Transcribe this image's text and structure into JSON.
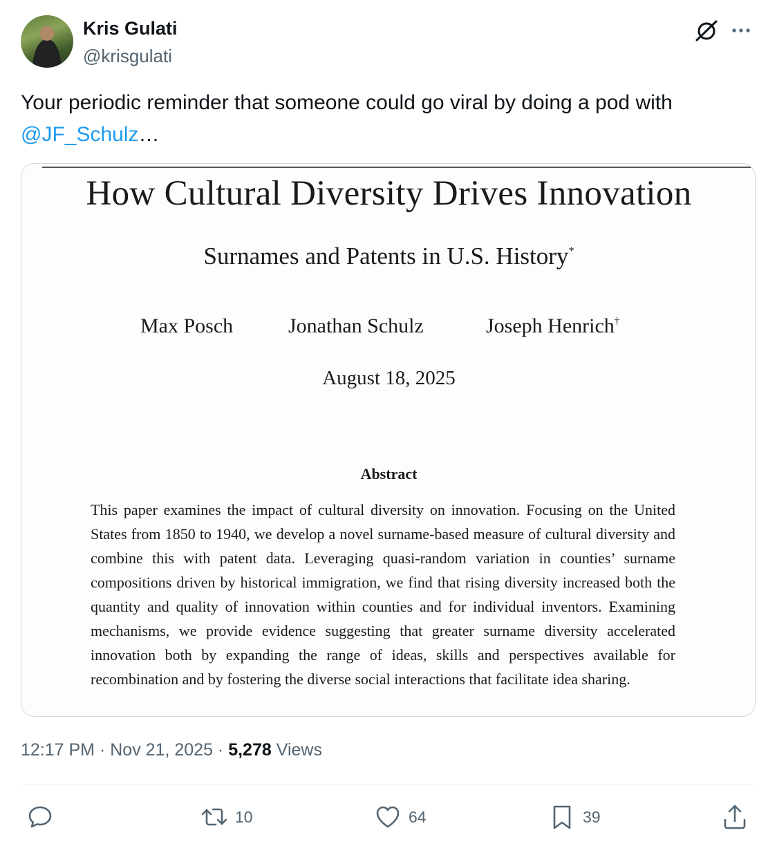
{
  "author": {
    "name": "Kris Gulati",
    "handle": "@krisgulati",
    "avatar_icon": "profile-photo"
  },
  "tweet": {
    "text": "Your periodic reminder that someone  could go viral by doing a pod with",
    "mention": "@JF_Schulz",
    "ellipsis": "…"
  },
  "media": {
    "title": "How Cultural Diversity Drives Innovation",
    "subtitle": "Surnames and Patents in U.S. History",
    "subtitle_mark": "*",
    "authors": [
      {
        "name": "Max Posch",
        "mark": ""
      },
      {
        "name": "Jonathan Schulz",
        "mark": ""
      },
      {
        "name": "Joseph Henrich",
        "mark": "†"
      }
    ],
    "date": "August 18, 2025",
    "abstract_heading": "Abstract",
    "abstract_text": "This paper examines the impact of cultural diversity on innovation. Focusing on the United States from 1850 to 1940, we develop a novel surname-based measure of cultural diversity and combine this with patent data. Leveraging quasi-random variation in counties’ surname compositions driven by historical immigration, we find that rising diversity increased both the quantity and quality of innovation within counties and for individual inventors. Examining mechanisms, we provide evidence suggesting that greater surname diversity accelerated innovation both by expanding the range of ideas, skills and perspectives available for recombination and by fostering the diverse social interactions that facilitate idea sharing."
  },
  "meta": {
    "time": "12:17 PM",
    "sep1": "·",
    "date": "Nov 21, 2025",
    "sep2": "·",
    "views_count": "5,278",
    "views_label": "Views"
  },
  "actions": {
    "reply": {
      "icon": "reply-icon",
      "count": ""
    },
    "repost": {
      "icon": "repost-icon",
      "count": "10"
    },
    "like": {
      "icon": "heart-icon",
      "count": "64"
    },
    "bookmark": {
      "icon": "bookmark-icon",
      "count": "39"
    },
    "share": {
      "icon": "share-icon",
      "count": ""
    }
  },
  "colors": {
    "text": "#0f1419",
    "secondary": "#536471",
    "link": "#1d9bf0",
    "border": "#cfd9de"
  }
}
